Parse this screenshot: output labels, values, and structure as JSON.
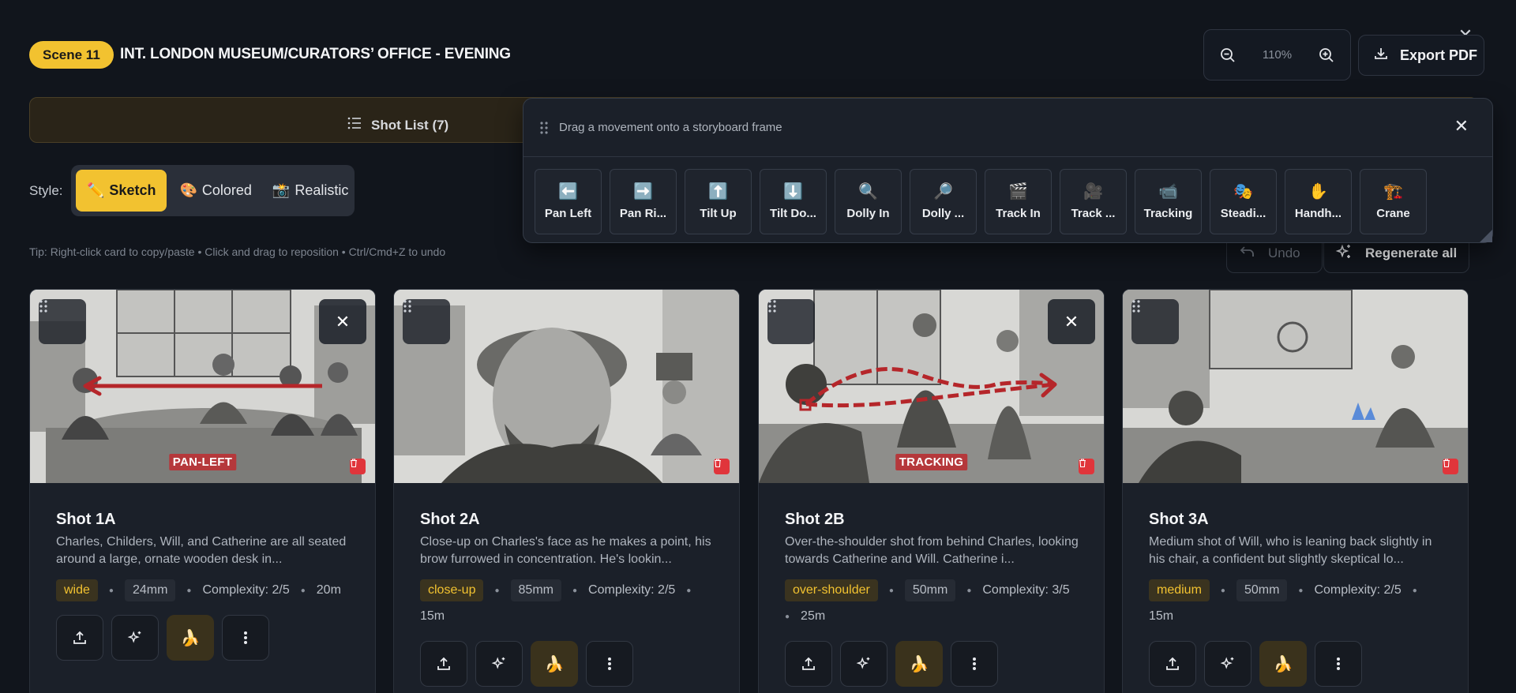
{
  "header": {
    "scene_badge": "Scene 11",
    "scene_title": "INT. LONDON MUSEUM/CURATORS’ OFFICE - EVENING",
    "zoom": "110%",
    "export_label": "Export PDF",
    "close_icon": "close-icon"
  },
  "shot_list": {
    "label": "Shot List (7)"
  },
  "style": {
    "label": "Style:",
    "options": [
      {
        "icon": "✏️",
        "label": "Sketch",
        "active": true
      },
      {
        "icon": "🎨",
        "label": "Colored",
        "active": false
      },
      {
        "icon": "📸",
        "label": "Realistic",
        "active": false
      }
    ]
  },
  "tip": "Tip: Right-click card to copy/paste • Click and drag to reposition • Ctrl/Cmd+Z to undo",
  "toolbar": {
    "undo_label": "Undo",
    "regenerate_label": "Regenerate all"
  },
  "palette": {
    "title": "Drag a movement onto a storyboard frame",
    "movements": [
      {
        "icon": "⬅️",
        "label": "Pan Left"
      },
      {
        "icon": "➡️",
        "label": "Pan Ri..."
      },
      {
        "icon": "⬆️",
        "label": "Tilt Up"
      },
      {
        "icon": "⬇️",
        "label": "Tilt Do..."
      },
      {
        "icon": "🔍",
        "label": "Dolly In"
      },
      {
        "icon": "🔎",
        "label": "Dolly ..."
      },
      {
        "icon": "🎬",
        "label": "Track In"
      },
      {
        "icon": "🎥",
        "label": "Track ..."
      },
      {
        "icon": "📹",
        "label": "Tracking"
      },
      {
        "icon": "🎭",
        "label": "Steadi..."
      },
      {
        "icon": "✋",
        "label": "Handh..."
      },
      {
        "icon": "🏗️",
        "label": "Crane"
      }
    ]
  },
  "cards": [
    {
      "title": "Shot 1A",
      "description": "Charles, Childers, Will, and Catherine are all seated around a large, ornate wooden desk in...",
      "shot_type": "wide",
      "lens": "24mm",
      "complexity": "Complexity: 2/5",
      "duration": "20m",
      "movement_tag": "PAN-LEFT"
    },
    {
      "title": "Shot 2A",
      "description": "Close-up on Charles's face as he makes a point, his brow furrowed in concentration. He's lookin...",
      "shot_type": "close-up",
      "lens": "85mm",
      "complexity": "Complexity: 2/5",
      "duration": "15m",
      "movement_tag": ""
    },
    {
      "title": "Shot 2B",
      "description": "Over-the-shoulder shot from behind Charles, looking towards Catherine and Will. Catherine i...",
      "shot_type": "over-shoulder",
      "lens": "50mm",
      "complexity": "Complexity: 3/5",
      "duration": "25m",
      "movement_tag": "TRACKING"
    },
    {
      "title": "Shot 3A",
      "description": "Medium shot of Will, who is leaning back slightly in his chair, a confident but slightly skeptical lo...",
      "shot_type": "medium",
      "lens": "50mm",
      "complexity": "Complexity: 2/5",
      "duration": "15m",
      "movement_tag": ""
    }
  ],
  "colors": {
    "accent": "#f2c230",
    "background": "#11151c",
    "card": "#1b2029",
    "danger": "#e0353b",
    "movement_arrow": "#b5262a"
  }
}
